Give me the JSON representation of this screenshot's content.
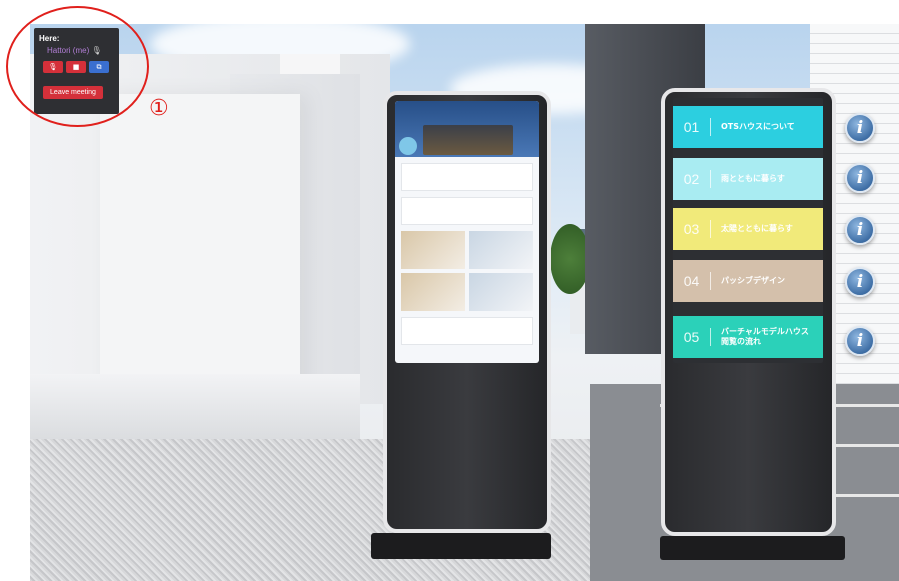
{
  "meeting": {
    "here_label": "Here:",
    "user_name": "Hattori (me)",
    "mic_glyph": "🎙",
    "controls": [
      {
        "icon": "mic-off-icon",
        "glyph": "🎙",
        "color": "#d4303a"
      },
      {
        "icon": "camera-off-icon",
        "glyph": "■",
        "color": "#d4303a"
      },
      {
        "icon": "screen-share-icon",
        "glyph": "⧉",
        "color": "#3a6fd0"
      }
    ],
    "leave_label": "Leave meeting"
  },
  "callout": {
    "number": "①",
    "color": "#e0201c"
  },
  "menu": {
    "items": [
      {
        "num": "01",
        "label": "OTSハウスについて",
        "color": "#2ccfe0"
      },
      {
        "num": "02",
        "label": "雨とともに暮らす",
        "color": "#a9ecf2"
      },
      {
        "num": "03",
        "label": "太陽とともに暮らす",
        "color": "#f1ea7a"
      },
      {
        "num": "04",
        "label": "パッシブデザイン",
        "color": "#d4c0ab"
      },
      {
        "num": "05",
        "label": "バーチャルモデルハウス\n閲覧の流れ",
        "color": "#2bd1b9"
      }
    ]
  },
  "info_button": {
    "glyph": "i",
    "count": 5
  }
}
